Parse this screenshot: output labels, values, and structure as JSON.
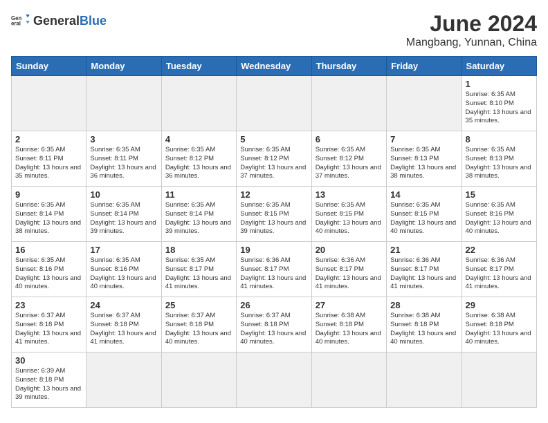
{
  "header": {
    "logo_general": "General",
    "logo_blue": "Blue",
    "month": "June 2024",
    "location": "Mangbang, Yunnan, China"
  },
  "days_of_week": [
    "Sunday",
    "Monday",
    "Tuesday",
    "Wednesday",
    "Thursday",
    "Friday",
    "Saturday"
  ],
  "weeks": [
    [
      {
        "day": "",
        "info": ""
      },
      {
        "day": "",
        "info": ""
      },
      {
        "day": "",
        "info": ""
      },
      {
        "day": "",
        "info": ""
      },
      {
        "day": "",
        "info": ""
      },
      {
        "day": "",
        "info": ""
      },
      {
        "day": "1",
        "info": "Sunrise: 6:35 AM\nSunset: 8:10 PM\nDaylight: 13 hours and 35 minutes."
      }
    ],
    [
      {
        "day": "2",
        "info": "Sunrise: 6:35 AM\nSunset: 8:11 PM\nDaylight: 13 hours and 35 minutes."
      },
      {
        "day": "3",
        "info": "Sunrise: 6:35 AM\nSunset: 8:11 PM\nDaylight: 13 hours and 36 minutes."
      },
      {
        "day": "4",
        "info": "Sunrise: 6:35 AM\nSunset: 8:12 PM\nDaylight: 13 hours and 36 minutes."
      },
      {
        "day": "5",
        "info": "Sunrise: 6:35 AM\nSunset: 8:12 PM\nDaylight: 13 hours and 37 minutes."
      },
      {
        "day": "6",
        "info": "Sunrise: 6:35 AM\nSunset: 8:12 PM\nDaylight: 13 hours and 37 minutes."
      },
      {
        "day": "7",
        "info": "Sunrise: 6:35 AM\nSunset: 8:13 PM\nDaylight: 13 hours and 38 minutes."
      },
      {
        "day": "8",
        "info": "Sunrise: 6:35 AM\nSunset: 8:13 PM\nDaylight: 13 hours and 38 minutes."
      }
    ],
    [
      {
        "day": "9",
        "info": "Sunrise: 6:35 AM\nSunset: 8:14 PM\nDaylight: 13 hours and 38 minutes."
      },
      {
        "day": "10",
        "info": "Sunrise: 6:35 AM\nSunset: 8:14 PM\nDaylight: 13 hours and 39 minutes."
      },
      {
        "day": "11",
        "info": "Sunrise: 6:35 AM\nSunset: 8:14 PM\nDaylight: 13 hours and 39 minutes."
      },
      {
        "day": "12",
        "info": "Sunrise: 6:35 AM\nSunset: 8:15 PM\nDaylight: 13 hours and 39 minutes."
      },
      {
        "day": "13",
        "info": "Sunrise: 6:35 AM\nSunset: 8:15 PM\nDaylight: 13 hours and 40 minutes."
      },
      {
        "day": "14",
        "info": "Sunrise: 6:35 AM\nSunset: 8:15 PM\nDaylight: 13 hours and 40 minutes."
      },
      {
        "day": "15",
        "info": "Sunrise: 6:35 AM\nSunset: 8:16 PM\nDaylight: 13 hours and 40 minutes."
      }
    ],
    [
      {
        "day": "16",
        "info": "Sunrise: 6:35 AM\nSunset: 8:16 PM\nDaylight: 13 hours and 40 minutes."
      },
      {
        "day": "17",
        "info": "Sunrise: 6:35 AM\nSunset: 8:16 PM\nDaylight: 13 hours and 40 minutes."
      },
      {
        "day": "18",
        "info": "Sunrise: 6:35 AM\nSunset: 8:17 PM\nDaylight: 13 hours and 41 minutes."
      },
      {
        "day": "19",
        "info": "Sunrise: 6:36 AM\nSunset: 8:17 PM\nDaylight: 13 hours and 41 minutes."
      },
      {
        "day": "20",
        "info": "Sunrise: 6:36 AM\nSunset: 8:17 PM\nDaylight: 13 hours and 41 minutes."
      },
      {
        "day": "21",
        "info": "Sunrise: 6:36 AM\nSunset: 8:17 PM\nDaylight: 13 hours and 41 minutes."
      },
      {
        "day": "22",
        "info": "Sunrise: 6:36 AM\nSunset: 8:17 PM\nDaylight: 13 hours and 41 minutes."
      }
    ],
    [
      {
        "day": "23",
        "info": "Sunrise: 6:37 AM\nSunset: 8:18 PM\nDaylight: 13 hours and 41 minutes."
      },
      {
        "day": "24",
        "info": "Sunrise: 6:37 AM\nSunset: 8:18 PM\nDaylight: 13 hours and 41 minutes."
      },
      {
        "day": "25",
        "info": "Sunrise: 6:37 AM\nSunset: 8:18 PM\nDaylight: 13 hours and 40 minutes."
      },
      {
        "day": "26",
        "info": "Sunrise: 6:37 AM\nSunset: 8:18 PM\nDaylight: 13 hours and 40 minutes."
      },
      {
        "day": "27",
        "info": "Sunrise: 6:38 AM\nSunset: 8:18 PM\nDaylight: 13 hours and 40 minutes."
      },
      {
        "day": "28",
        "info": "Sunrise: 6:38 AM\nSunset: 8:18 PM\nDaylight: 13 hours and 40 minutes."
      },
      {
        "day": "29",
        "info": "Sunrise: 6:38 AM\nSunset: 8:18 PM\nDaylight: 13 hours and 40 minutes."
      }
    ],
    [
      {
        "day": "30",
        "info": "Sunrise: 6:39 AM\nSunset: 8:18 PM\nDaylight: 13 hours and 39 minutes."
      },
      {
        "day": "",
        "info": ""
      },
      {
        "day": "",
        "info": ""
      },
      {
        "day": "",
        "info": ""
      },
      {
        "day": "",
        "info": ""
      },
      {
        "day": "",
        "info": ""
      },
      {
        "day": "",
        "info": ""
      }
    ]
  ]
}
